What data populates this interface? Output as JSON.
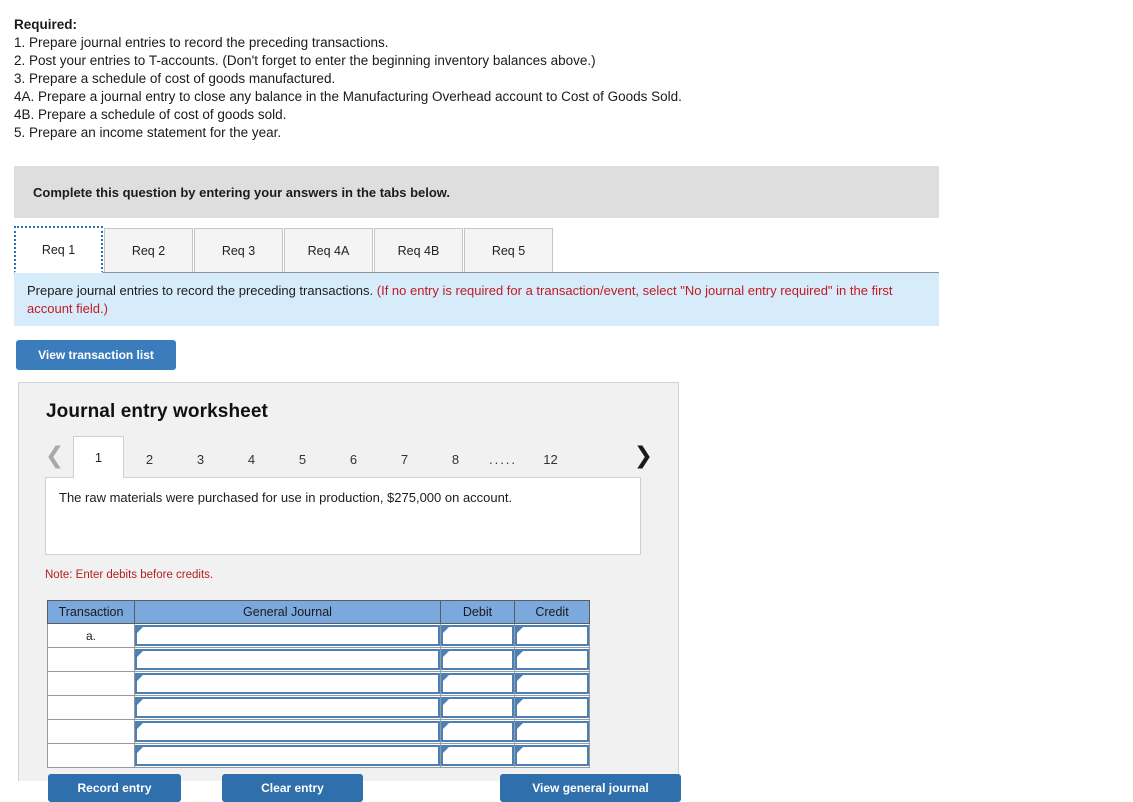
{
  "required": {
    "title": "Required:",
    "items": [
      "1. Prepare journal entries to record the preceding transactions.",
      "2. Post your entries to T-accounts. (Don't forget to enter the beginning inventory balances above.)",
      "3. Prepare a schedule of cost of goods manufactured.",
      "4A. Prepare a journal entry to close any balance in the Manufacturing Overhead account to Cost of Goods Sold.",
      "4B. Prepare a schedule of cost of goods sold.",
      "5. Prepare an income statement for the year."
    ]
  },
  "banner": {
    "text": "Complete this question by entering your answers in the tabs below."
  },
  "tabs": {
    "items": [
      {
        "label": "Req 1",
        "active": true
      },
      {
        "label": "Req 2",
        "active": false
      },
      {
        "label": "Req 3",
        "active": false
      },
      {
        "label": "Req 4A",
        "active": false
      },
      {
        "label": "Req 4B",
        "active": false
      },
      {
        "label": "Req 5",
        "active": false
      }
    ]
  },
  "instruction": {
    "main": "Prepare journal entries to record the preceding transactions. ",
    "hint": "(If no entry is required for a transaction/event, select \"No journal entry required\" in the first account field.)"
  },
  "buttons": {
    "view_transaction_list": "View transaction list",
    "record_entry": "Record entry",
    "clear_entry": "Clear entry",
    "view_general_journal": "View general journal"
  },
  "worksheet": {
    "title": "Journal entry worksheet",
    "pager": {
      "prev_icon": "chevron-left-icon",
      "next_icon": "chevron-right-icon",
      "pages": [
        "1",
        "2",
        "3",
        "4",
        "5",
        "6",
        "7",
        "8"
      ],
      "ellipsis": ".....",
      "last_page": "12",
      "active_page": "1"
    },
    "description": "The raw materials were purchased for use in production, $275,000 on account.",
    "note": "Note: Enter debits before credits.",
    "table": {
      "headers": [
        "Transaction",
        "General Journal",
        "Debit",
        "Credit"
      ],
      "rows": [
        {
          "transaction": "a.",
          "general_journal": "",
          "debit": "",
          "credit": ""
        },
        {
          "transaction": "",
          "general_journal": "",
          "debit": "",
          "credit": ""
        },
        {
          "transaction": "",
          "general_journal": "",
          "debit": "",
          "credit": ""
        },
        {
          "transaction": "",
          "general_journal": "",
          "debit": "",
          "credit": ""
        },
        {
          "transaction": "",
          "general_journal": "",
          "debit": "",
          "credit": ""
        },
        {
          "transaction": "",
          "general_journal": "",
          "debit": "",
          "credit": ""
        }
      ]
    }
  },
  "colors": {
    "banner_gray": "#dedede",
    "instruction_blue": "#d7ecfb",
    "instruction_red": "#c21a22",
    "button_blue": "#3b7dbc",
    "table_header_blue": "#7ba9dd",
    "input_border_blue": "#4a80b5",
    "panel_gray": "#f1f1f1"
  }
}
